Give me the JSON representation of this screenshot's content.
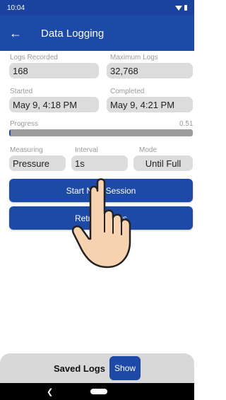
{
  "status_bar": {
    "time": "10:04"
  },
  "app_bar": {
    "title": "Data Logging",
    "back_icon": "arrow-left-icon"
  },
  "fields": {
    "logs_recorded": {
      "label": "Logs Recorded",
      "value": "168"
    },
    "maximum_logs": {
      "label": "Maximum Logs",
      "value": "32,768"
    },
    "started": {
      "label": "Started",
      "value": "May 9, 4:18 PM"
    },
    "completed": {
      "label": "Completed",
      "value": "May 9, 4:21 PM"
    },
    "measuring": {
      "label": "Measuring",
      "value": "Pressure"
    },
    "interval": {
      "label": "Interval",
      "value": "1s"
    },
    "mode": {
      "label": "Mode",
      "value": "Until Full"
    }
  },
  "progress": {
    "label": "Progress",
    "value": "0.51",
    "fraction": 0.0051
  },
  "buttons": {
    "start_new_session": "Start New Session",
    "retrieve_logs": "Retrieve Logs"
  },
  "saved_logs": {
    "label": "Saved Logs",
    "show_label": "Show"
  },
  "colors": {
    "primary": "#1c4aa8",
    "field_bg": "#dcdcdc",
    "label_gray": "#9a9a9a"
  }
}
